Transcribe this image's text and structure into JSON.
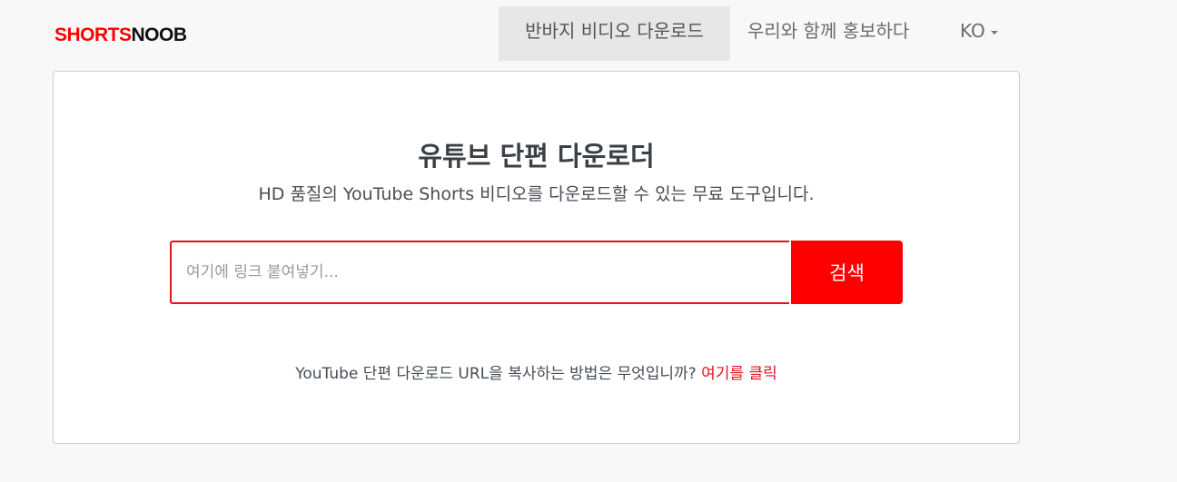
{
  "header": {
    "logo_part1": "SHORTS",
    "logo_part2": "NOOB",
    "nav": {
      "download_shorts": "반바지 비디오 다운로드",
      "promote": "우리와 함께 홍보하다",
      "language": "KO"
    }
  },
  "main": {
    "title": "유튜브 단편 다운로더",
    "subtitle": "HD 품질의 YouTube Shorts 비디오를 다운로드할 수 있는 무료 도구입니다.",
    "search": {
      "placeholder": "여기에 링크 붙여넣기...",
      "value": "",
      "button_label": "검색"
    },
    "howto": {
      "question": "YouTube 단편 다운로드 URL을 복사하는 방법은 무엇입니까? ",
      "link_label": "여기를 클릭"
    }
  },
  "colors": {
    "accent": "#ff0000",
    "page_background": "#f8f8f8",
    "card_background": "#ffffff",
    "nav_active_background": "#e7e7e7"
  }
}
